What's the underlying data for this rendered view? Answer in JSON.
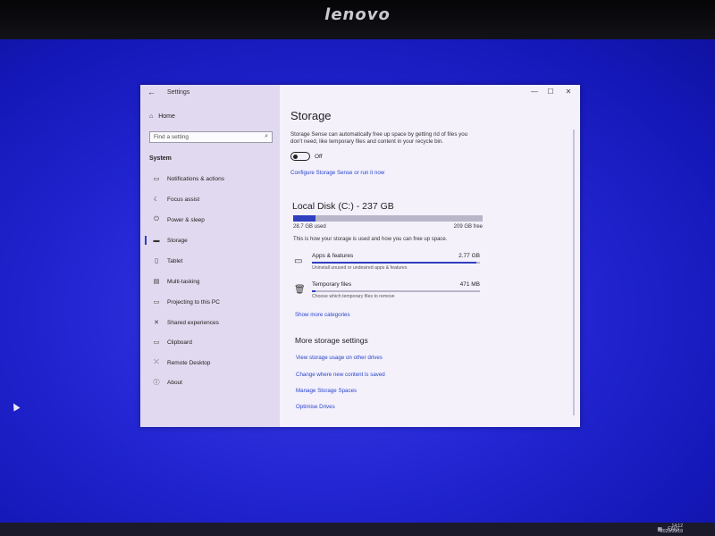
{
  "monitor": {
    "brand": "lenovo"
  },
  "window": {
    "title": "Settings",
    "controls": {
      "minimize": "—",
      "maximize": "☐",
      "close": "✕"
    }
  },
  "sidebar": {
    "home_label": "Home",
    "search_placeholder": "Find a setting",
    "section_label": "System",
    "items": [
      {
        "label": "Notifications & actions",
        "icon": "notifications-icon",
        "glyph": "▭"
      },
      {
        "label": "Focus assist",
        "icon": "moon-icon",
        "glyph": "☾"
      },
      {
        "label": "Power & sleep",
        "icon": "power-icon",
        "glyph": "⏻"
      },
      {
        "label": "Storage",
        "icon": "storage-icon",
        "glyph": "▬"
      },
      {
        "label": "Tablet",
        "icon": "tablet-icon",
        "glyph": "▯"
      },
      {
        "label": "Multi-tasking",
        "icon": "multitasking-icon",
        "glyph": "▤"
      },
      {
        "label": "Projecting to this PC",
        "icon": "projecting-icon",
        "glyph": "▭"
      },
      {
        "label": "Shared experiences",
        "icon": "shared-experiences-icon",
        "glyph": "✕"
      },
      {
        "label": "Clipboard",
        "icon": "clipboard-icon",
        "glyph": "▭"
      },
      {
        "label": "Remote Desktop",
        "icon": "remote-desktop-icon",
        "glyph": "⤫"
      },
      {
        "label": "About",
        "icon": "info-icon",
        "glyph": "ⓘ"
      }
    ]
  },
  "main": {
    "title": "Storage",
    "description": "Storage Sense can automatically free up space by getting rid of files you don't need, like temporary files and content in your recycle bin.",
    "toggle_label": "Off",
    "configure_link": "Configure Storage Sense or run it now",
    "disk": {
      "title": "Local Disk (C:) - 237 GB",
      "used": "28.7 GB used",
      "free": "209 GB free",
      "used_fraction": 0.12,
      "info": "This is how your storage is used and how you can free up space."
    },
    "categories": [
      {
        "name": "Apps & features",
        "size": "2.77 GB",
        "desc": "Uninstall unused or undesired apps & features",
        "fraction": 0.98
      },
      {
        "name": "Temporary files",
        "size": "471 MB",
        "desc": "Choose which temporary files to remove",
        "fraction": 0.02
      }
    ],
    "show_more": "Show more categories",
    "more_title": "More storage settings",
    "more_links": [
      "View storage usage on other drives",
      "Change where new content is saved",
      "Manage Storage Spaces",
      "Optimise Drives"
    ]
  },
  "taskbar": {
    "language": "ENG",
    "time": "14:12",
    "date": "2023/09/18"
  },
  "colors": {
    "accent": "#2f3fbf",
    "link": "#2a45c8",
    "desktop": "#2326d2"
  }
}
